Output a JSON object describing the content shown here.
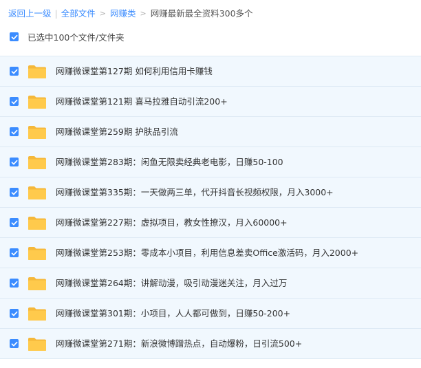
{
  "breadcrumb": {
    "back": "返回上一级",
    "all_files": "全部文件",
    "category": "网赚类",
    "current": "网赚最新最全资料300多个"
  },
  "selection": {
    "label": "已选中100个文件/文件夹"
  },
  "icons": {
    "checkbox": "checkbox-checked-icon",
    "folder": "folder-icon"
  },
  "colors": {
    "accent": "#3b8cff",
    "folder": "#ffc94a",
    "row_bg": "#f1f8fe"
  },
  "files": [
    {
      "name": "网赚微课堂第127期 如何利用信用卡赚钱"
    },
    {
      "name": "网赚微课堂第121期 喜马拉雅自动引流200+"
    },
    {
      "name": "网赚微课堂第259期 护肤品引流"
    },
    {
      "name": "网赚微课堂第283期：闲鱼无限卖经典老电影，日赚50-100"
    },
    {
      "name": "网赚微课堂第335期：一天做两三单，代开抖音长视频权限，月入3000+"
    },
    {
      "name": "网赚微课堂第227期：虚拟项目，教女性撩汉，月入60000+"
    },
    {
      "name": "网赚微课堂第253期：零成本小项目，利用信息差卖Office激活码，月入2000+"
    },
    {
      "name": "网赚微课堂第264期：讲解动漫，吸引动漫迷关注，月入过万"
    },
    {
      "name": "网赚微课堂第301期：小项目，人人都可做到，日赚50-200+"
    },
    {
      "name": "网赚微课堂第271期：新浪微博蹭热点，自动爆粉，日引流500+"
    }
  ]
}
